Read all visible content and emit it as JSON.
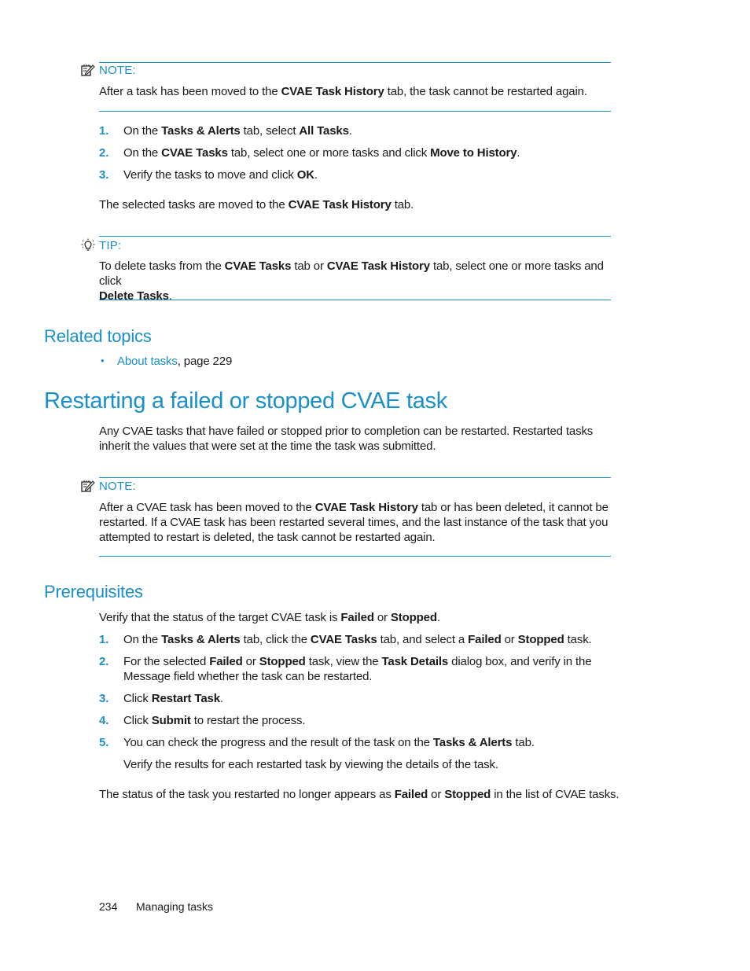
{
  "note1": {
    "label": "NOTE:",
    "text": [
      "After a task has been moved to the ",
      "CVAE Task History",
      " tab, the task cannot be restarted again."
    ]
  },
  "steps1": [
    {
      "num": "1.",
      "parts": [
        "On the ",
        "Tasks & Alerts",
        " tab, select ",
        "All Tasks",
        "."
      ]
    },
    {
      "num": "2.",
      "parts": [
        "On the ",
        "CVAE Tasks",
        " tab, select one or more tasks and click ",
        "Move to History",
        "."
      ]
    },
    {
      "num": "3.",
      "parts": [
        "Verify the tasks to move and click ",
        "OK",
        "."
      ]
    }
  ],
  "result1": [
    "The selected tasks are moved to the ",
    "CVAE Task History",
    " tab."
  ],
  "tip": {
    "label": "TIP:",
    "line1": [
      "To delete tasks from the ",
      "CVAE Tasks",
      " tab or ",
      "CVAE Task History",
      " tab, select one or more tasks and click"
    ],
    "line2": [
      "Delete Tasks",
      "."
    ]
  },
  "related": {
    "heading": "Related topics",
    "items": [
      {
        "link": "About tasks",
        "suffix": ", page 229"
      }
    ]
  },
  "section": {
    "title": "Restarting a failed or stopped CVAE task",
    "intro_line1": "Any CVAE tasks that have failed or stopped prior to completion can be restarted. Restarted tasks",
    "intro_line2": "inherit the values that were set at the time the task was submitted."
  },
  "note2": {
    "label": "NOTE:",
    "line1": [
      "After a CVAE task has been moved to the ",
      "CVAE Task History",
      " tab or has been deleted, it cannot be"
    ],
    "line2": "restarted. If a CVAE task has been restarted several times, and the last instance of the task that you",
    "line3": "attempted to restart is deleted, the task cannot be restarted again."
  },
  "prereq": {
    "heading": "Prerequisites",
    "intro": [
      "Verify that the status of the target CVAE task is ",
      "Failed",
      " or ",
      "Stopped",
      "."
    ],
    "steps": [
      {
        "num": "1.",
        "parts": [
          "On the ",
          "Tasks & Alerts",
          " tab, click the ",
          "CVAE Tasks",
          " tab, and select a ",
          "Failed",
          " or ",
          "Stopped",
          " task."
        ]
      },
      {
        "num": "2.",
        "parts": [
          "For the selected ",
          "Failed",
          " or ",
          "Stopped",
          " task, view the ",
          "Task Details",
          " dialog box, and verify in the"
        ],
        "cont": "Message field whether the task can be restarted."
      },
      {
        "num": "3.",
        "parts": [
          "Click ",
          "Restart Task",
          "."
        ]
      },
      {
        "num": "4.",
        "parts": [
          "Click ",
          "Submit",
          " to restart the process."
        ]
      },
      {
        "num": "5.",
        "parts": [
          "You can check the progress and the result of the task on the ",
          "Tasks & Alerts",
          " tab."
        ],
        "cont": "Verify the results for each restarted task by viewing the details of the task."
      }
    ],
    "result": [
      "The status of the task you restarted no longer appears as ",
      "Failed",
      " or ",
      "Stopped",
      " in the list of CVAE tasks."
    ]
  },
  "footer": {
    "page_number": "234",
    "chapter": "Managing tasks"
  },
  "colors": {
    "accent": "#1a8fc8",
    "text": "#1a1a1a"
  }
}
